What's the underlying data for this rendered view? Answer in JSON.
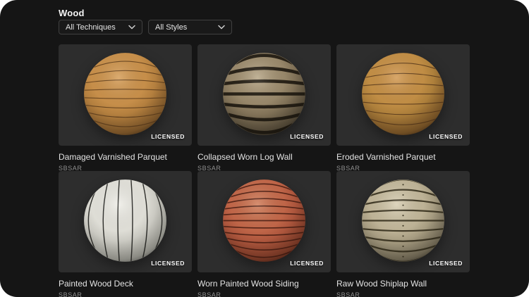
{
  "panel": {
    "background": "#151515",
    "tile_background": "#2d2d2d",
    "corner_radius_px": 24
  },
  "header": {
    "title": "Wood"
  },
  "filters": [
    {
      "label": "All Techniques",
      "icon": "chevron-down-icon"
    },
    {
      "label": "All Styles",
      "icon": "chevron-down-icon"
    }
  ],
  "materials": [
    {
      "name": "Damaged Varnished Parquet",
      "format": "SBSAR",
      "badge": "LICENSED",
      "sphere": {
        "style": "orange varnished wood planks, horizontal",
        "orient": "h",
        "lines": 10,
        "lw": 1.1,
        "light": "#d69f5b",
        "mid": "#c08843",
        "dark": "#6e4a22",
        "line": "#66431f",
        "dots": false
      }
    },
    {
      "name": "Collapsed Worn Log Wall",
      "format": "SBSAR",
      "badge": "LICENSED",
      "sphere": {
        "style": "weathered gray-brown stacked logs, horizontal",
        "orient": "h",
        "lines": 7,
        "lw": 4.5,
        "light": "#b8a788",
        "mid": "#8a7a5e",
        "dark": "#3e3628",
        "line": "#1f1a11",
        "dots": false
      }
    },
    {
      "name": "Eroded Varnished Parquet",
      "format": "SBSAR",
      "badge": "LICENSED",
      "sphere": {
        "style": "orange eroded wood planks, horizontal",
        "orient": "h",
        "lines": 9,
        "lw": 1.1,
        "light": "#d29a54",
        "mid": "#b9883f",
        "dark": "#6b4620",
        "line": "#5e3e1e",
        "dots": false
      }
    },
    {
      "name": "Painted Wood Deck",
      "format": "SBSAR",
      "badge": "LICENSED",
      "sphere": {
        "style": "white painted wood planks, vertical",
        "orient": "v",
        "lines": 6,
        "lw": 1.4,
        "light": "#efeee8",
        "mid": "#d8d7cf",
        "dark": "#8b8b82",
        "line": "#23231f",
        "dots": false
      }
    },
    {
      "name": "Worn Painted Wood Siding",
      "format": "SBSAR",
      "badge": "LICENSED",
      "sphere": {
        "style": "worn red painted siding, horizontal",
        "orient": "h",
        "lines": 13,
        "lw": 1.6,
        "light": "#d07e5b",
        "mid": "#b95c41",
        "dark": "#6a2e1c",
        "line": "#4e2115",
        "dots": false
      }
    },
    {
      "name": "Raw Wood Shiplap Wall",
      "format": "SBSAR",
      "badge": "LICENSED",
      "sphere": {
        "style": "raw tan shiplap planks with nails, horizontal",
        "orient": "h",
        "lines": 9,
        "lw": 2.2,
        "light": "#d9cfb4",
        "mid": "#b2a78a",
        "dark": "#5e5644",
        "line": "#38321f",
        "dots": true
      }
    }
  ]
}
